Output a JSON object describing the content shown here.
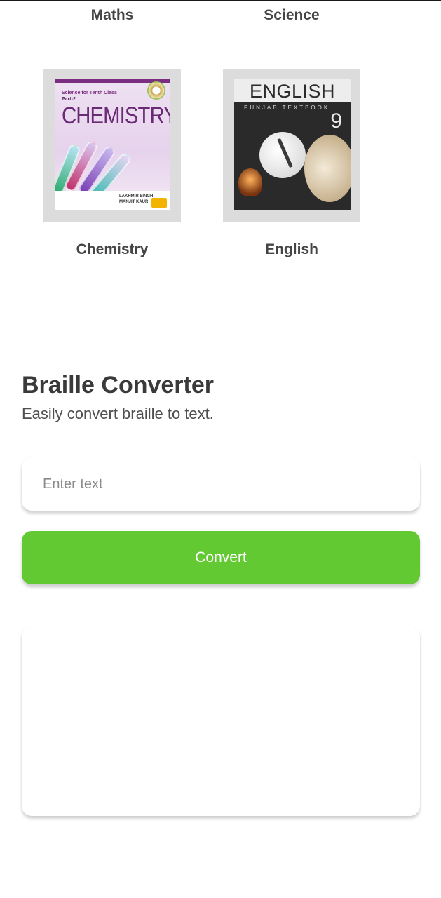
{
  "subjects": {
    "row1": [
      {
        "label": "Maths"
      },
      {
        "label": "Science"
      }
    ],
    "row2": [
      {
        "label": "Chemistry",
        "cover": {
          "series": "Science for Tenth Class",
          "part": "Part-2",
          "title": "CHEMISTRY",
          "authors": "LAKHMIR SINGH\nMANJIT KAUR"
        }
      },
      {
        "label": "English",
        "cover": {
          "title": "ENGLISH",
          "subtitle": "PUNJAB TEXTBOOK",
          "number": "9"
        }
      }
    ]
  },
  "braille": {
    "title": "Braille Converter",
    "subtitle": "Easily convert braille to text.",
    "input_placeholder": "Enter text",
    "input_value": "",
    "button_label": "Convert",
    "output_text": ""
  },
  "colors": {
    "accent": "#63c932",
    "text_primary": "#3a3a3a",
    "card_frame": "#dcdcdc"
  }
}
